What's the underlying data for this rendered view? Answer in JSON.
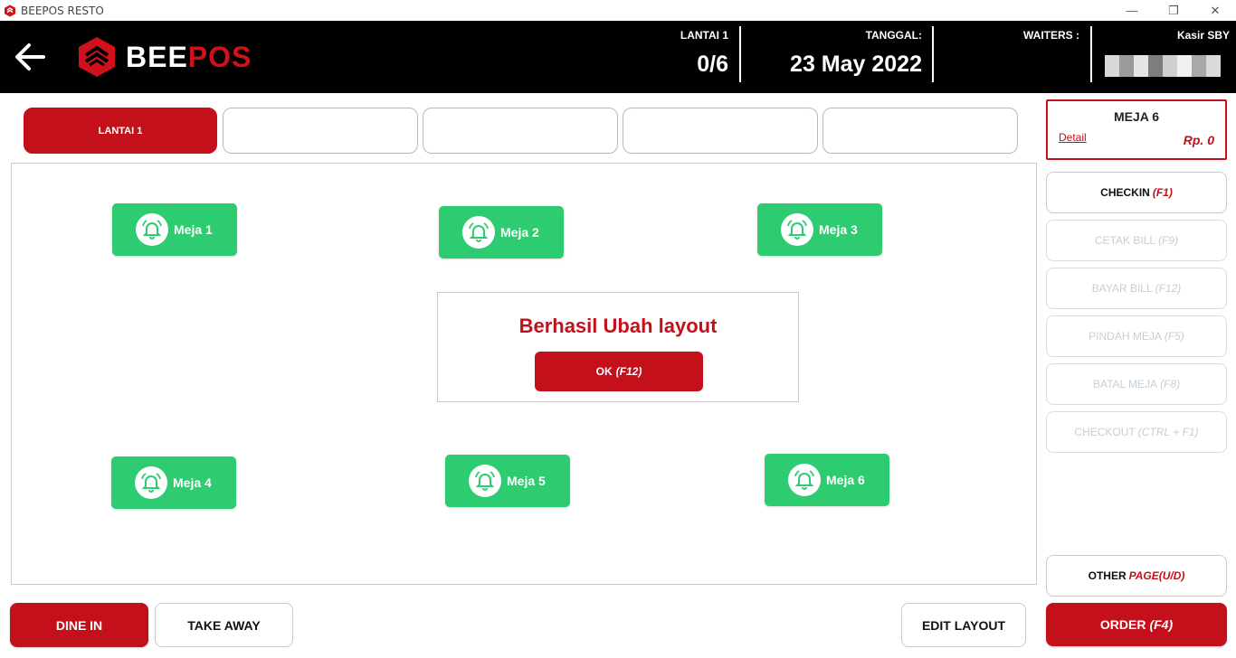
{
  "window": {
    "title": "BEEPOS RESTO",
    "minimize": "—",
    "restore": "❐",
    "close": "✕"
  },
  "header": {
    "logo_part1": "BEE",
    "logo_part2": "POS",
    "floor_label": "LANTAI 1",
    "floor_value": "0/6",
    "date_label": "TANGGAL:",
    "date_value": "23 May 2022",
    "waiters_label": "WAITERS :",
    "cashier_label": "Kasir SBY"
  },
  "floor_tabs": [
    {
      "label": "LANTAI 1",
      "active": true
    },
    {
      "label": "",
      "active": false
    },
    {
      "label": "",
      "active": false
    },
    {
      "label": "",
      "active": false
    },
    {
      "label": "",
      "active": false
    }
  ],
  "tables": [
    {
      "label": "Meja 1"
    },
    {
      "label": "Meja 2"
    },
    {
      "label": "Meja 3"
    },
    {
      "label": "Meja 4"
    },
    {
      "label": "Meja 5"
    },
    {
      "label": "Meja 6"
    }
  ],
  "dialog": {
    "message": "Berhasil Ubah layout",
    "ok_label": "OK",
    "ok_key": "(F12)"
  },
  "selected_table": {
    "name": "MEJA 6",
    "detail_link": "Detail",
    "price": "Rp. 0"
  },
  "actions": {
    "checkin": {
      "label": "CHECKIN",
      "key": "(F1)"
    },
    "cetak_bill": {
      "label": "CETAK BILL",
      "key": "(F9)"
    },
    "bayar_bill": {
      "label": "BAYAR BILL",
      "key": "(F12)"
    },
    "pindah_meja": {
      "label": "PINDAH MEJA",
      "key": "(F5)"
    },
    "batal_meja": {
      "label": "BATAL MEJA",
      "key": "(F8)"
    },
    "checkout": {
      "label": "CHECKOUT",
      "key": "(CTRL + F1)"
    },
    "other_page": {
      "label": "OTHER",
      "key": "PAGE(U/D)"
    },
    "order": {
      "label": "ORDER",
      "key": "(F4)"
    }
  },
  "bottom": {
    "dine_in": "DINE IN",
    "take_away": "TAKE AWAY",
    "edit_layout": "EDIT LAYOUT"
  },
  "colors": {
    "brand_red": "#c4101a",
    "table_green": "#2ecc71",
    "header_bg": "#000000"
  }
}
